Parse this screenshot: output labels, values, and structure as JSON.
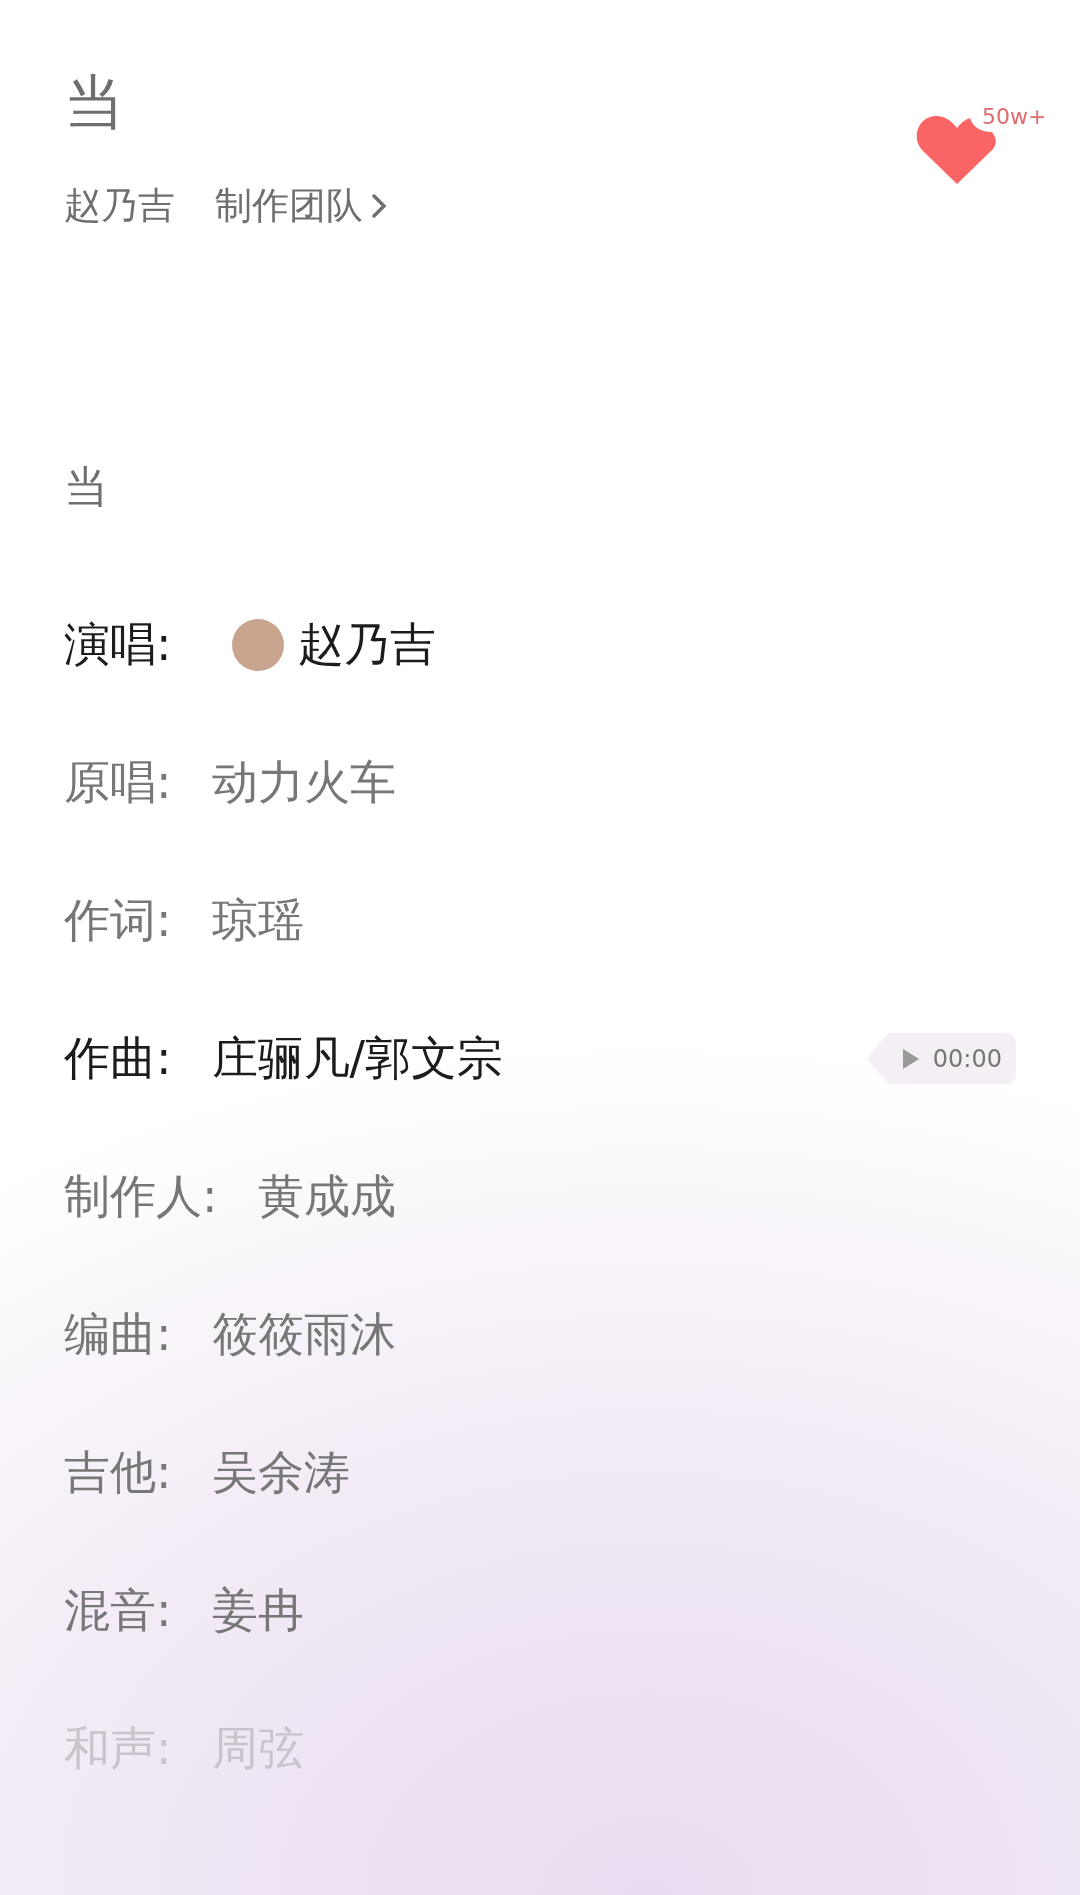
{
  "song": {
    "title": "当",
    "artist": "赵乃吉",
    "team_link": "制作团队",
    "likes": "50w+"
  },
  "lyrics_title": "当",
  "credits": [
    {
      "kind": "avatar",
      "label": "演唱:",
      "value": "赵乃吉",
      "highlighted": true,
      "faded": false
    },
    {
      "kind": "plain",
      "label": "原唱:",
      "value": "动力火车",
      "highlighted": false,
      "faded": false
    },
    {
      "kind": "plain",
      "label": "作词:",
      "value": "琼瑶",
      "highlighted": false,
      "faded": false
    },
    {
      "kind": "preview",
      "label": "作曲:",
      "value": "庄骊凡/郭文宗",
      "highlighted": true,
      "faded": false,
      "time": "00:00"
    },
    {
      "kind": "plain",
      "label": "制作人:",
      "value": "黄成成",
      "highlighted": false,
      "faded": false
    },
    {
      "kind": "plain",
      "label": "编曲:",
      "value": "筱筱雨沐",
      "highlighted": false,
      "faded": false
    },
    {
      "kind": "plain",
      "label": "吉他:",
      "value": "吴余涛",
      "highlighted": false,
      "faded": false
    },
    {
      "kind": "plain",
      "label": "混音:",
      "value": "姜冉",
      "highlighted": false,
      "faded": false
    },
    {
      "kind": "plain",
      "label": "和声:",
      "value": "周弦",
      "highlighted": false,
      "faded": true
    }
  ]
}
